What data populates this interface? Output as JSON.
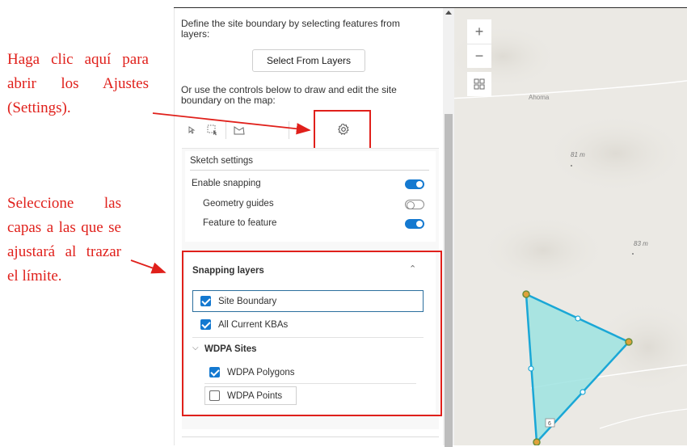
{
  "annotations": {
    "settings_hint": "Haga clic aquí para abrir los Ajustes (Settings).",
    "layers_hint": "Seleccione las capas a las que se ajustará al trazar el límite."
  },
  "panel": {
    "define_text": "Define the site boundary by selecting features from layers:",
    "select_button": "Select From Layers",
    "or_use_text": "Or use the controls below to draw and edit the site boundary on the map:",
    "tools": [
      "select-icon",
      "box-select-icon",
      "polygon-icon",
      "settings-icon"
    ]
  },
  "sketch_settings": {
    "title": "Sketch settings",
    "enable_snapping": {
      "label": "Enable snapping",
      "on": true
    },
    "geometry_guides": {
      "label": "Geometry guides",
      "on": false
    },
    "feature_to_feature": {
      "label": "Feature to feature",
      "on": true
    }
  },
  "snapping_layers": {
    "title": "Snapping layers",
    "layers": [
      {
        "label": "Site Boundary",
        "checked": true
      },
      {
        "label": "All Current KBAs",
        "checked": true
      }
    ],
    "group": {
      "label": "WDPA Sites",
      "layers": [
        {
          "label": "WDPA Polygons",
          "checked": true
        },
        {
          "label": "WDPA Points",
          "checked": false
        }
      ]
    }
  },
  "map": {
    "place_label": "Ahoma",
    "elevation_labels": [
      "81 m",
      "83 m"
    ],
    "road_shield": "6",
    "controls": [
      "zoom-in-icon",
      "zoom-out-icon",
      "basemap-gallery-icon"
    ],
    "polygon_fill": "#9ee3e0",
    "polygon_stroke": "#1aa7d6"
  },
  "colors": {
    "annotation": "#e0201b",
    "accent": "#1479d0"
  }
}
